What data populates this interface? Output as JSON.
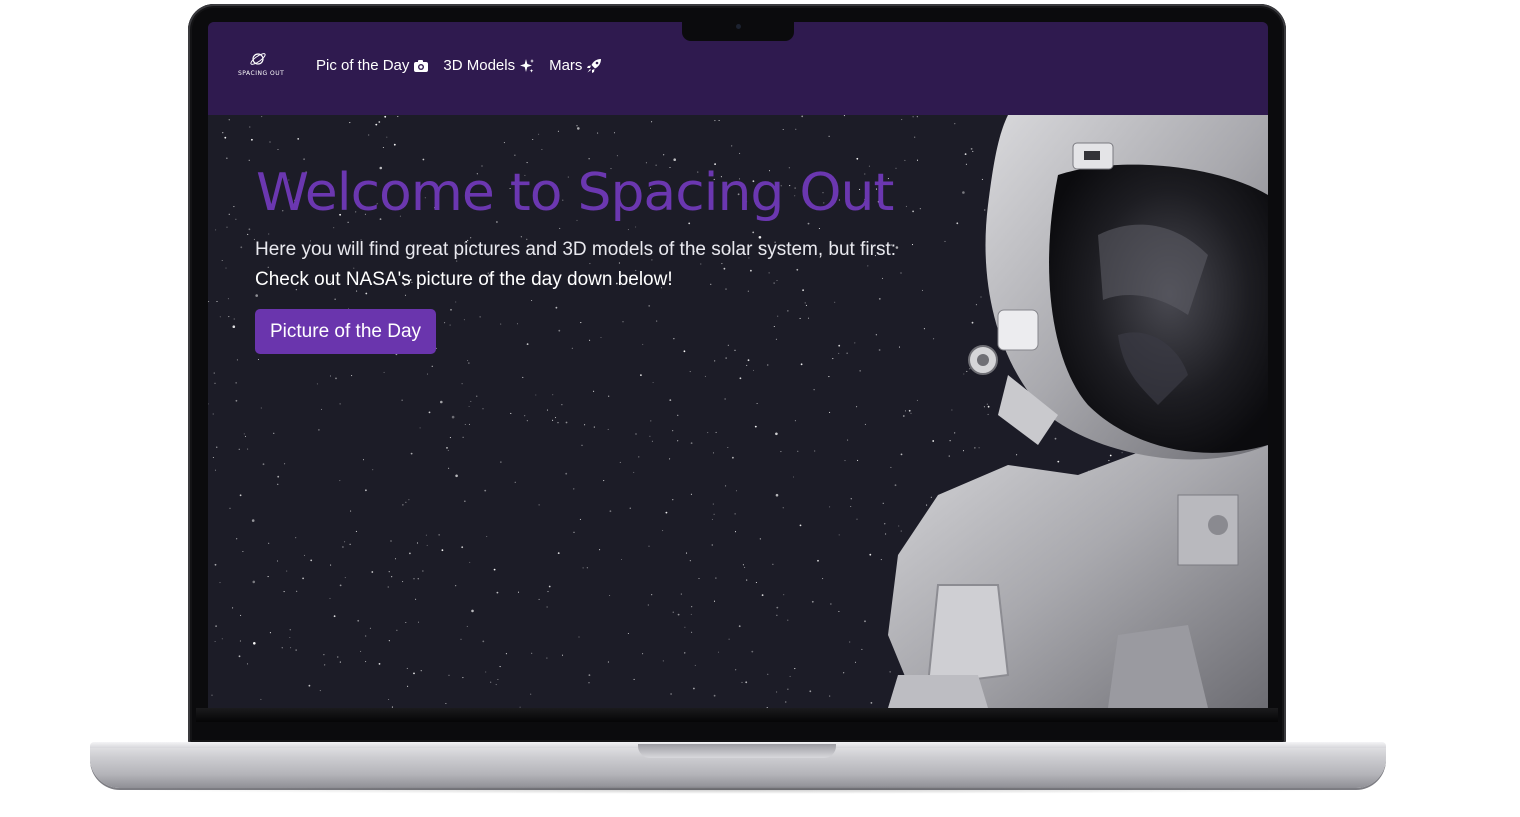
{
  "site": {
    "logo_text": "SPACING OUT"
  },
  "nav": {
    "items": [
      {
        "label": "Pic of the Day",
        "icon": "camera-icon"
      },
      {
        "label": "3D Models",
        "icon": "sparkles-icon"
      },
      {
        "label": "Mars",
        "icon": "rocket-icon"
      }
    ]
  },
  "hero": {
    "title": "Welcome to Spacing Out",
    "subtitle": "Here you will find great pictures and 3D models of the solar system, but first:",
    "subtitle_bold": "Check out NASA's picture of the day down below!",
    "cta_label": "Picture of the Day"
  },
  "colors": {
    "navbar": "#2f1a4f",
    "accent": "#6a35ad",
    "title": "#6b37b0",
    "hero_bg": "#1c1c27"
  }
}
